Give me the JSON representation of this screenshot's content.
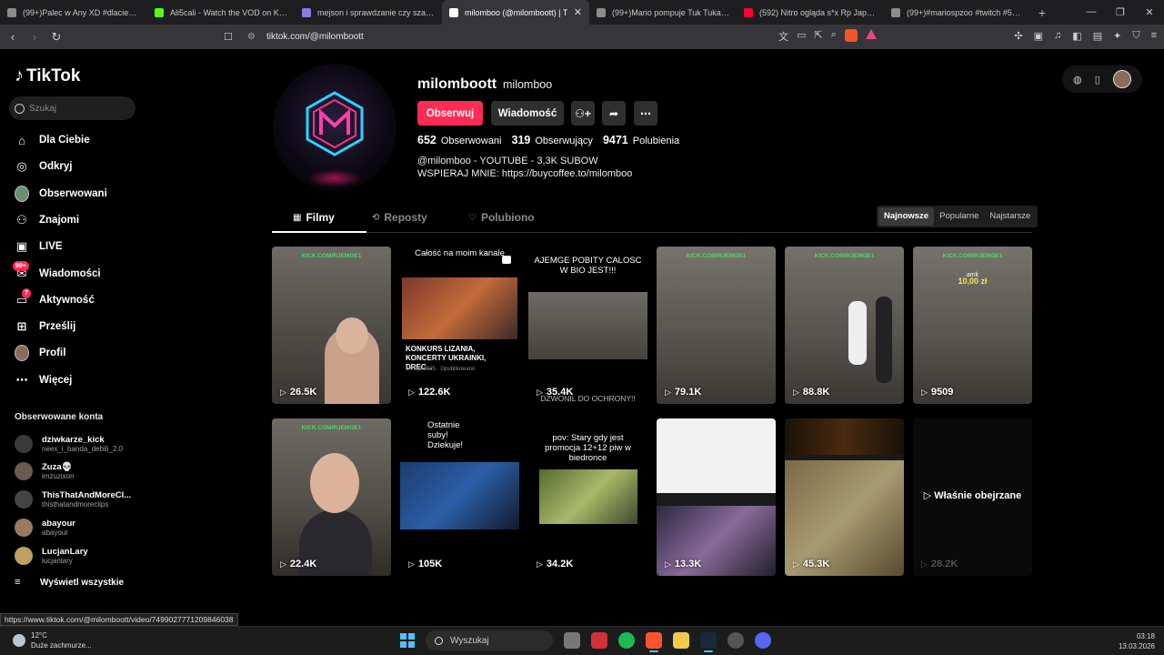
{
  "browser": {
    "tabs": [
      {
        "title": "(99+)Palec w Any XD #dlaciebie #dc",
        "color": "#8c8c8c"
      },
      {
        "title": "Ali5cali - Watch the VOD on Kick",
        "color": "#53fc18"
      },
      {
        "title": "mejson i sprawdzanie czy szafka dzia",
        "color": "#8c7ae6"
      },
      {
        "title": "milomboo (@milomboott) | T",
        "color": "#ffffff",
        "active": true
      },
      {
        "title": "(99+)Mario pompuje Tuk Tuka #mar",
        "color": "#8c8c8c"
      },
      {
        "title": "(592) Nitro ogląda s*x Rp Japczana -",
        "color": "#ff0033"
      },
      {
        "title": "(99+)#mariospzoo #twitch #5city #n",
        "color": "#8c8c8c"
      }
    ],
    "url": "tiktok.com/@milomboott",
    "status_url": "https://www.tiktok.com/@milomboott/video/7499027771209846038"
  },
  "sidebar": {
    "logo": "TikTok",
    "search_placeholder": "Szukaj",
    "nav": [
      {
        "label": "Dla Ciebie",
        "icon": "home-icon"
      },
      {
        "label": "Odkryj",
        "icon": "compass-icon"
      },
      {
        "label": "Obserwowani",
        "icon": "avatar"
      },
      {
        "label": "Znajomi",
        "icon": "friends-icon"
      },
      {
        "label": "LIVE",
        "icon": "live-icon"
      },
      {
        "label": "Wiadomości",
        "icon": "messages-icon",
        "badge": "99+"
      },
      {
        "label": "Aktywność",
        "icon": "activity-icon",
        "badge": "7"
      },
      {
        "label": "Prześlij",
        "icon": "upload-icon"
      },
      {
        "label": "Profil",
        "icon": "profile-avatar"
      },
      {
        "label": "Więcej",
        "icon": "more-icon"
      }
    ],
    "following_header": "Obserwowane konta",
    "following": [
      {
        "name": "dziwkarze_kick",
        "handle": "neex_i_banda_debili_2.0",
        "color": "#3a3a3a"
      },
      {
        "name": "Zuza💀",
        "handle": "imzuzixon",
        "color": "#6b5a50"
      },
      {
        "name": "ThisThatAndMoreCl...",
        "handle": "thisthatandmoreclips",
        "color": "#444"
      },
      {
        "name": "abayour",
        "handle": "abayour",
        "color": "#9a7a60"
      },
      {
        "name": "LucjanLary",
        "handle": "lucjanlary",
        "color": "#c0a060"
      }
    ],
    "show_all": "Wyświetl wszystkie"
  },
  "profile": {
    "username": "milomboott",
    "nickname": "milomboo",
    "follow_label": "Obserwuj",
    "message_label": "Wiadomość",
    "stats": [
      {
        "value": "652",
        "label": "Obserwowani"
      },
      {
        "value": "319",
        "label": "Obserwujący"
      },
      {
        "value": "9471",
        "label": "Polubienia"
      }
    ],
    "bio_line1": "@milomboo - YOUTUBE - 3,3K SUBOW",
    "bio_line2": "WSPIERAJ MNIE: https://buycoffee.to/milomboo",
    "tabs": [
      "Filmy",
      "Reposty",
      "Polubiono"
    ],
    "sort": [
      "Najnowsze",
      "Popularne",
      "Najstarsze"
    ]
  },
  "videos": [
    {
      "views": "26.5K",
      "watermark": "KICK.COM/RJEMGE1",
      "bg": "#5a5650"
    },
    {
      "views": "122.6K",
      "caption_top": "Całość na moim kanale",
      "inner_title": "KONKURS LIZANIA, KONCERTY UKRAINKI, DREC...",
      "inner_date": "8 maja 2025 · Opublikowano",
      "bg": "#000"
    },
    {
      "views": "35.4K",
      "caption_top": "AJEMGE POBITY CALOSC W BIO JEST!!!",
      "caption_bottom": "DZWONIL DO OCHRONY!!",
      "bg": "#000"
    },
    {
      "views": "79.1K",
      "watermark": "KICK.COM/RJEMGE1",
      "bg": "#57544f"
    },
    {
      "views": "88.8K",
      "watermark": "KICK.COM/RJEMGE1",
      "bg": "#5c5853"
    },
    {
      "views": "9509",
      "watermark": "KICK.COM/RJEMGE1",
      "donation_amount": "amk",
      "donation_value": "10,00 zł",
      "bg": "#5e5a55"
    },
    {
      "views": "22.4K",
      "watermark": "KICK.COM/RJEMGE1",
      "bg": "#5a5650"
    },
    {
      "views": "105K",
      "caption_top": "Ostatnie suby! Dziekuje!",
      "bg": "#000"
    },
    {
      "views": "34.2K",
      "caption_top": "pov: Stary gdy jest promocja 12+12 piw w biedronce",
      "bg": "#000"
    },
    {
      "views": "13.3K",
      "bg": "#1c1c1c"
    },
    {
      "views": "45.3K",
      "bg": "#2a2218"
    },
    {
      "views": "28.2K",
      "watched_label": "Właśnie obejrzane",
      "bg": "#0a0a0a"
    }
  ],
  "taskbar": {
    "temp": "12°C",
    "weather": "Duże zachmurze...",
    "search": "Wyszukaj",
    "time": "03:18",
    "date": "13.03.2026"
  }
}
